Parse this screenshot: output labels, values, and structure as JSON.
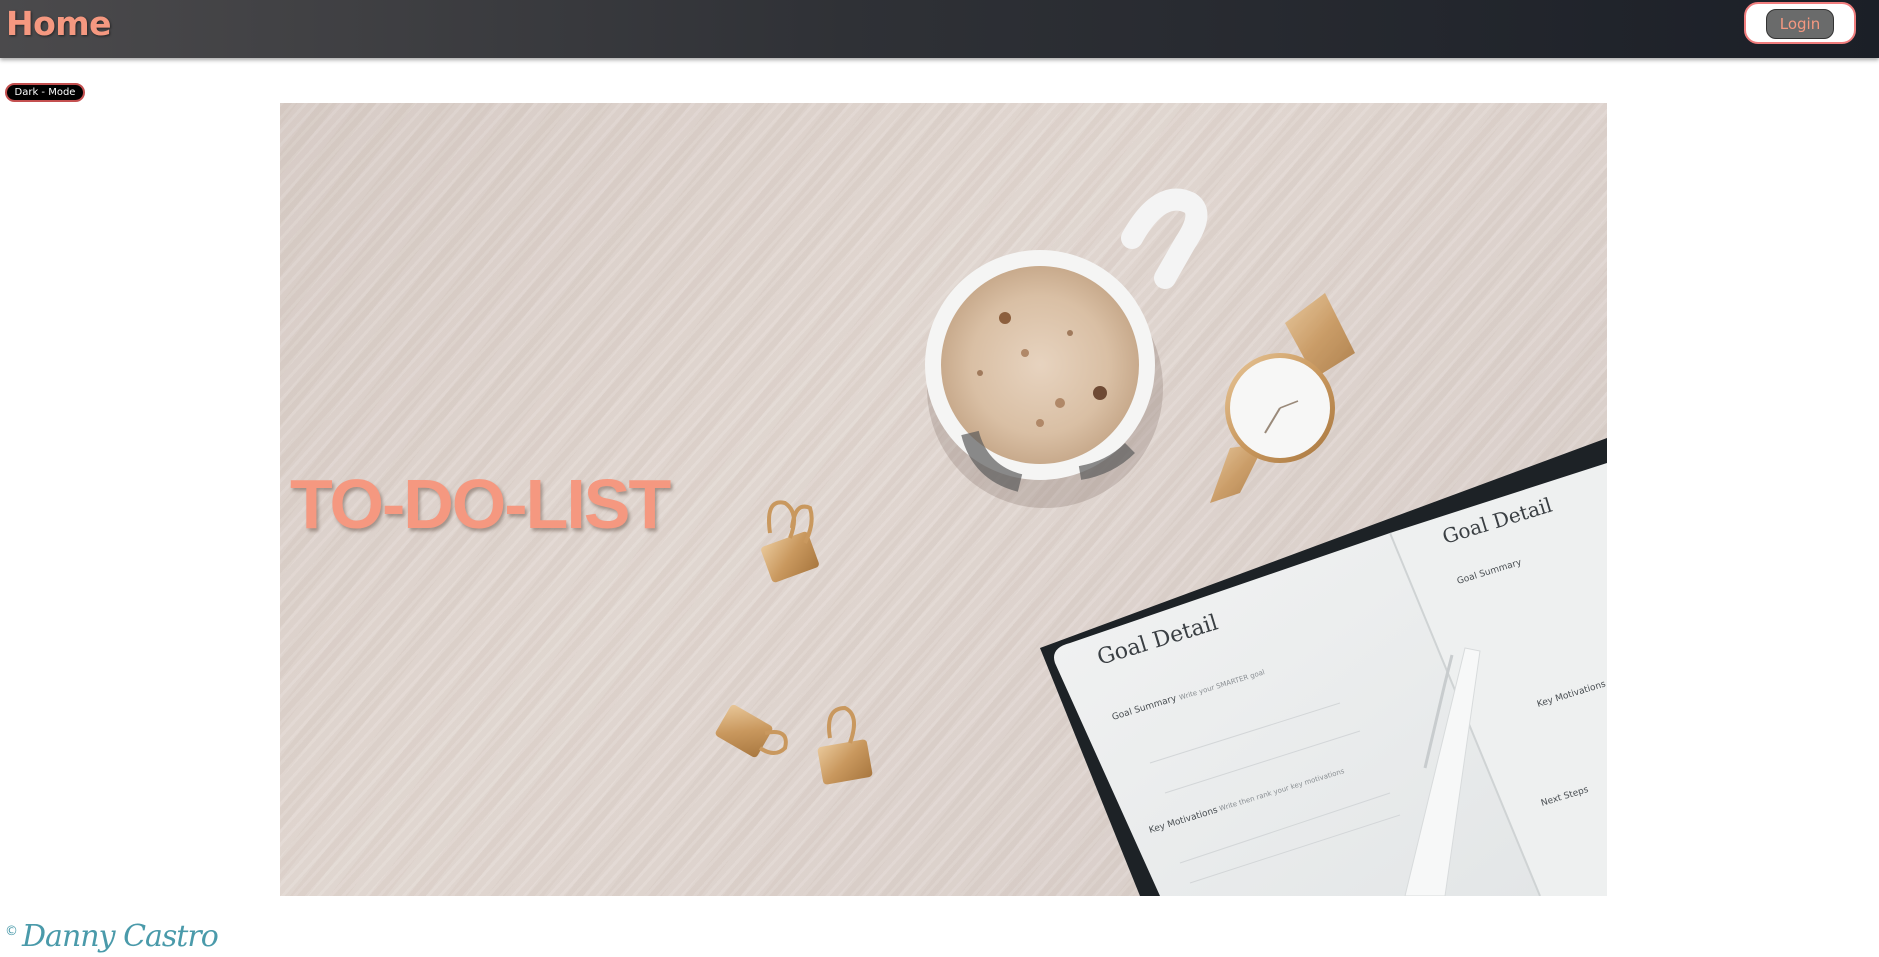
{
  "navbar": {
    "brand": "Home",
    "login_label": "Login"
  },
  "controls": {
    "dark_mode_label": "Dark - Mode"
  },
  "hero": {
    "title": "TO-DO-LIST",
    "notebook_heading": "Goal Detail",
    "notebook_summary_label": "Goal Summary",
    "notebook_summary_hint": "Write your SMARTER goal",
    "notebook_motivations_label": "Key Motivations",
    "notebook_motivations_hint": "Write then rank your key motivations",
    "notebook_next_steps_label": "Next Steps"
  },
  "footer": {
    "copyright_symbol": "©",
    "signature": "Danny Castro"
  },
  "colors": {
    "accent": "#f59880",
    "navbar_dark": "#1b1f27",
    "signature": "#4a9aaa"
  }
}
